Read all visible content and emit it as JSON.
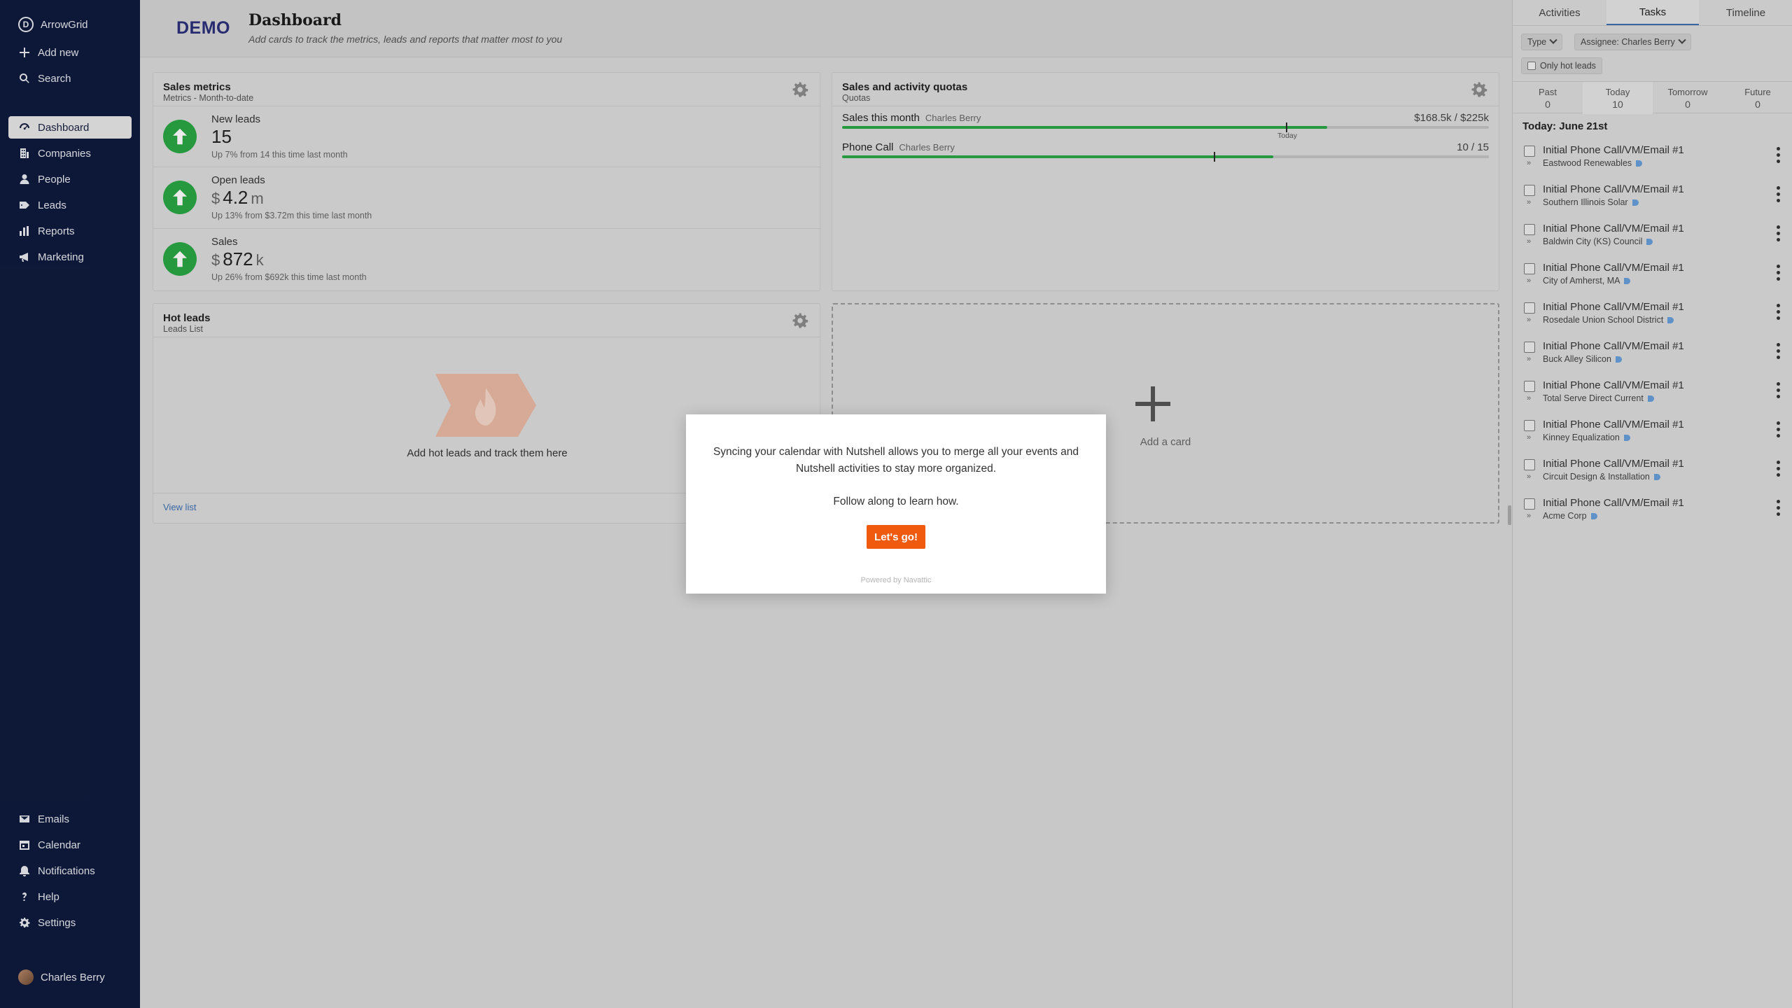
{
  "sidebar": {
    "brand": "ArrowGrid",
    "brand_initial": "D",
    "top_items": [
      {
        "label": "Add new",
        "icon": "plus-icon"
      },
      {
        "label": "Search",
        "icon": "search-icon"
      }
    ],
    "nav_items": [
      {
        "label": "Dashboard",
        "icon": "gauge-icon",
        "active": true
      },
      {
        "label": "Companies",
        "icon": "building-icon"
      },
      {
        "label": "People",
        "icon": "person-icon"
      },
      {
        "label": "Leads",
        "icon": "tag-icon"
      },
      {
        "label": "Reports",
        "icon": "bar-chart-icon"
      },
      {
        "label": "Marketing",
        "icon": "megaphone-icon"
      }
    ],
    "bottom_items": [
      {
        "label": "Emails",
        "icon": "envelope-icon"
      },
      {
        "label": "Calendar",
        "icon": "calendar-icon"
      },
      {
        "label": "Notifications",
        "icon": "bell-icon"
      },
      {
        "label": "Help",
        "icon": "question-icon"
      },
      {
        "label": "Settings",
        "icon": "gear-icon"
      }
    ],
    "user": "Charles Berry"
  },
  "header": {
    "demo": "DEMO",
    "title": "Dashboard",
    "subtitle": "Add cards to track the metrics, leads and reports that matter most to you"
  },
  "sales_metrics": {
    "title": "Sales metrics",
    "subtitle": "Metrics - Month-to-date",
    "items": [
      {
        "label": "New leads",
        "currency": "",
        "value": "15",
        "unit": "",
        "note": "Up 7% from 14 this time last month"
      },
      {
        "label": "Open leads",
        "currency": "$",
        "value": "4.2",
        "unit": "m",
        "note": "Up 13% from $3.72m this time last month"
      },
      {
        "label": "Sales",
        "currency": "$",
        "value": "872",
        "unit": "k",
        "note": "Up 26% from $692k this time last month"
      }
    ]
  },
  "quotas": {
    "title": "Sales and activity quotas",
    "subtitle": "Quotas",
    "today_label": "Today",
    "items": [
      {
        "label": "Sales this month",
        "owner": "Charles Berry",
        "value": "$168.5k / $225k",
        "progress": 0.75
      },
      {
        "label": "Phone Call",
        "owner": "Charles Berry",
        "value": "10 / 15",
        "progress": 0.667
      }
    ]
  },
  "hot_leads": {
    "title": "Hot leads",
    "subtitle": "Leads List",
    "empty_text": "Add hot leads and track them here",
    "view_list": "View list"
  },
  "add_card": {
    "label": "Add a card"
  },
  "right_panel": {
    "tabs": [
      {
        "label": "Activities"
      },
      {
        "label": "Tasks",
        "active": true
      },
      {
        "label": "Timeline"
      }
    ],
    "filter_type": "Type",
    "filter_assignee": "Assignee: Charles Berry",
    "only_hot_leads": "Only hot leads",
    "date_columns": [
      {
        "label": "Past",
        "count": "0"
      },
      {
        "label": "Today",
        "count": "10",
        "active": true
      },
      {
        "label": "Tomorrow",
        "count": "0"
      },
      {
        "label": "Future",
        "count": "0"
      }
    ],
    "today_heading": "Today: June 21st",
    "tasks": [
      {
        "title": "Initial Phone Call/VM/Email #1",
        "company": "Eastwood Renewables"
      },
      {
        "title": "Initial Phone Call/VM/Email #1",
        "company": "Southern Illinois Solar"
      },
      {
        "title": "Initial Phone Call/VM/Email #1",
        "company": "Baldwin City (KS) Council"
      },
      {
        "title": "Initial Phone Call/VM/Email #1",
        "company": "City of Amherst, MA"
      },
      {
        "title": "Initial Phone Call/VM/Email #1",
        "company": "Rosedale Union School District"
      },
      {
        "title": "Initial Phone Call/VM/Email #1",
        "company": "Buck Alley Silicon"
      },
      {
        "title": "Initial Phone Call/VM/Email #1",
        "company": "Total Serve Direct Current"
      },
      {
        "title": "Initial Phone Call/VM/Email #1",
        "company": "Kinney Equalization"
      },
      {
        "title": "Initial Phone Call/VM/Email #1",
        "company": "Circuit Design & Installation"
      },
      {
        "title": "Initial Phone Call/VM/Email #1",
        "company": "Acme Corp"
      }
    ],
    "task_prefix": "»"
  },
  "modal": {
    "text": "Syncing your calendar with Nutshell allows you to merge all your events and Nutshell activities to stay more organized.",
    "follow": "Follow along to learn how.",
    "button": "Let's go!",
    "powered": "Powered by Navattic"
  },
  "colors": {
    "sidebar_bg": "#0f1b3d",
    "accent_green": "#2aa745",
    "cta_orange": "#f05a0e",
    "link_blue": "#3d6fb3"
  }
}
